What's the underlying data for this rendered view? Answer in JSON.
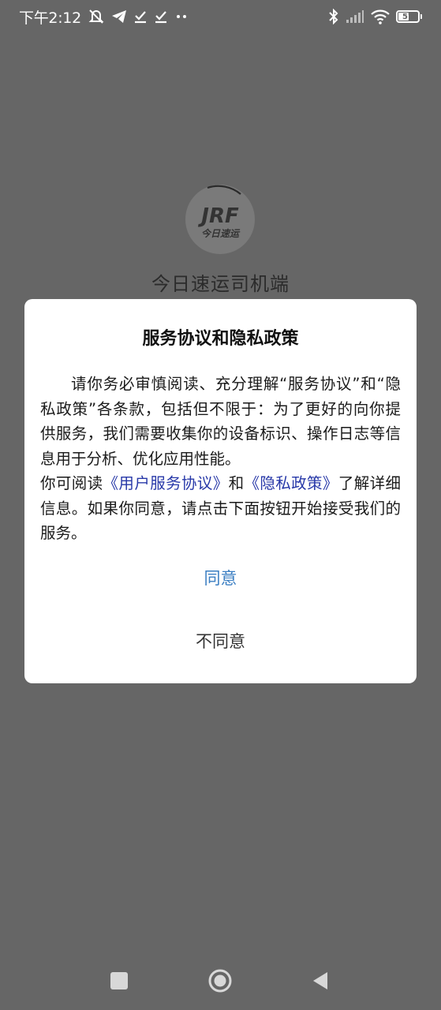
{
  "status_bar": {
    "time": "下午2:12",
    "battery": {
      "text": "57",
      "level": 0.57
    }
  },
  "splash": {
    "logo_text": "JRF",
    "logo_subtext": "今日速运",
    "app_name": "今日速运司机端"
  },
  "dialog": {
    "title": "服务协议和隐私政策",
    "paragraph1": "请你务必审慎阅读、充分理解“服务协议”和“隐私政策”各条款，包括但不限于：为了更好的向你提供服务，我们需要收集你的设备标识、操作日志等信息用于分析、优化应用性能。",
    "p2_prefix": "你可阅读",
    "user_agreement_link": "《用户服务协议》",
    "p2_and": "和",
    "privacy_policy_link": "《隐私政策》",
    "p2_suffix": "了解详细信息。如果你同意，请点击下面按钮开始接受我们的服务。",
    "agree_label": "同意",
    "disagree_label": "不同意"
  },
  "colors": {
    "overlay_background": "#666666",
    "link": "#2738a8",
    "agree": "#3a7ec2"
  },
  "nav_bar": {
    "icons": [
      "recents-square-icon",
      "home-circle-icon",
      "back-triangle-icon"
    ]
  }
}
